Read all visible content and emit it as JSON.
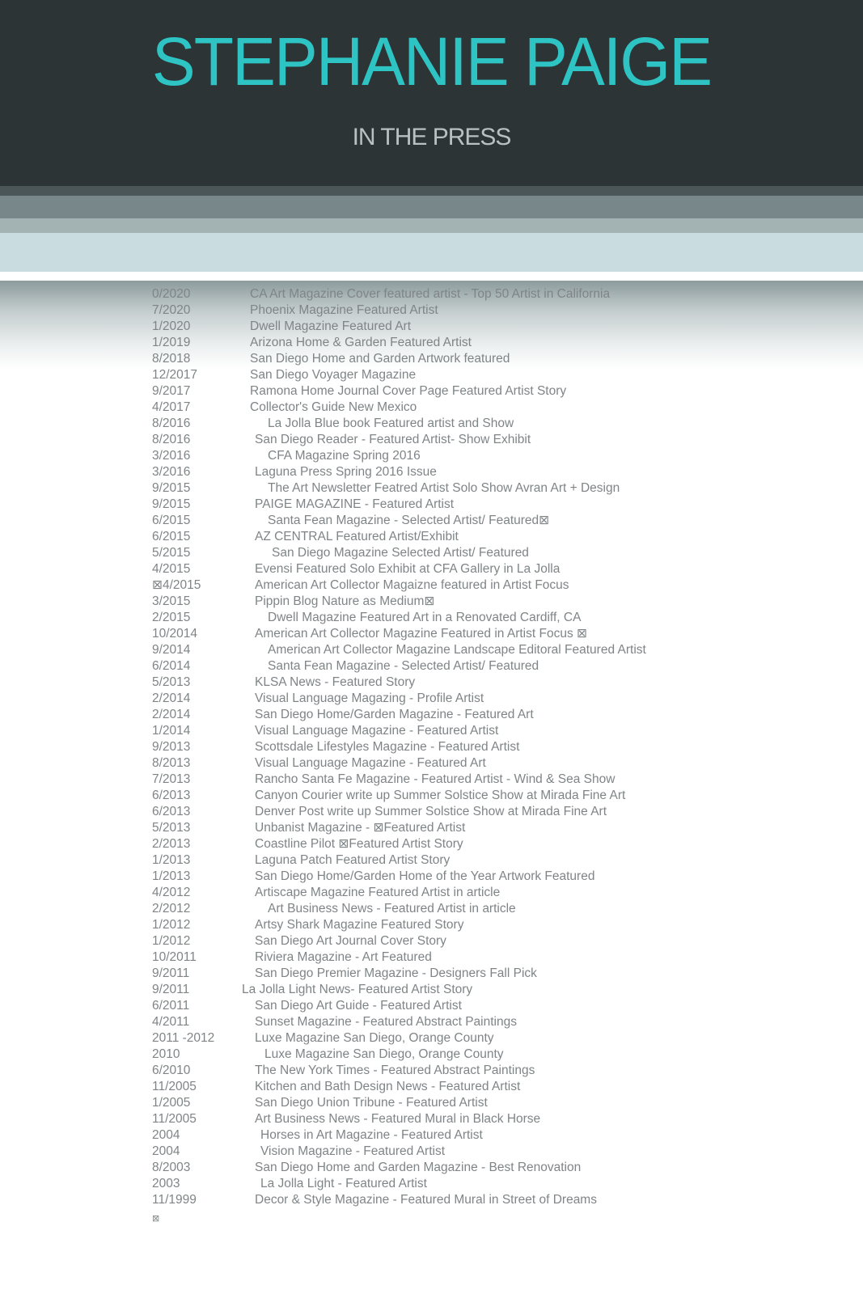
{
  "header": {
    "title": "STEPHANIE PAIGE",
    "subtitle": "IN THE PRESS"
  },
  "colors": {
    "header_bg": "#2d3436",
    "title": "#2ec4c4",
    "subtitle": "#b9c0c2",
    "text": "#7f8587"
  },
  "press": [
    {
      "date": "0/2020",
      "text": "CA Art Magazine Cover featured artist - Top 50 Artist in California"
    },
    {
      "date": "7/2020",
      "text": "Phoenix Magazine Featured Artist"
    },
    {
      "date": "1/2020",
      "text": "Dwell Magazine Featured Art"
    },
    {
      "date": "1/2019",
      "text": "Arizona Home & Garden Featured Artist"
    },
    {
      "date": "8/2018",
      "text": "San Diego Home and Garden Artwork featured"
    },
    {
      "date": "12/2017",
      "text": "San Diego Voyager Magazine"
    },
    {
      "date": "9/2017",
      "text": "Ramona Home Journal  Cover Page Featured Artist Story"
    },
    {
      "date": "4/2017",
      "text": "Collector's Guide  New Mexico"
    },
    {
      "date": "8/2016",
      "text": "La Jolla Blue  book Featured artist and Show"
    },
    {
      "date": "8/2016",
      "text": "San Diego Reader  - Featured Artist- Show Exhibit"
    },
    {
      "date": "3/2016",
      "text": "CFA Magazine Spring 2016"
    },
    {
      "date": "3/2016",
      "text": "Laguna Press Spring 2016 Issue"
    },
    {
      "date": "9/2015",
      "text": "The Art Newsletter  Featred Artist Solo Show Avran Art + Design"
    },
    {
      "date": "9/2015",
      "text": "PAIGE MAGAZINE  - Featured Artist"
    },
    {
      "date": "6/2015",
      "text": "Santa Fean Magazine -  Selected Artist/ Featured⊠"
    },
    {
      "date": "6/2015",
      "text": "AZ CENTRAL    Featured Artist/Exhibit"
    },
    {
      "date": "5/2015",
      "text": "San Diego Magazine Selected Artist/ Featured"
    },
    {
      "date": "4/2015",
      "text": "Evensi    Featured Solo Exhibit at CFA Gallery in La Jolla"
    },
    {
      "date": "⊠4/2015",
      "text": "American Art Collector Magaizne featured in Artist Focus"
    },
    {
      "date": "3/2015",
      "text": "Pippin Blog   Nature as Medium⊠"
    },
    {
      "date": "2/2015",
      "text": "Dwell Magazine Featured Art in a Renovated Cardiff, CA"
    },
    {
      "date": "10/2014",
      "text": "American Art Collector Magazine Featured in Artist Focus  ⊠"
    },
    {
      "date": "9/2014",
      "text": "American Art Collector Magazine  Landscape Editoral Featured Artist"
    },
    {
      "date": "6/2014",
      "text": "Santa Fean Magazine  - Selected Artist/ Featured"
    },
    {
      "date": "5/2013",
      "text": "KLSA News  - Featured Story"
    },
    {
      "date": "2/2014",
      "text": "Visual Language Magazing  - Profile Artist"
    },
    {
      "date": "2/2014",
      "text": "San Diego Home/Garden Magazine  - Featured Art"
    },
    {
      "date": "1/2014",
      "text": "Visual Language Magazine  - Featured   Artist"
    },
    {
      "date": "9/2013",
      "text": "Scottsdale Lifestyles Magazine  - Featured Artist"
    },
    {
      "date": "8/2013",
      "text": "Visual Language Magazine  - Featured Art"
    },
    {
      "date": "7/2013",
      "text": "Rancho Santa Fe Magazine  - Featured Artist - Wind & Sea Show"
    },
    {
      "date": "6/2013",
      "text": "Canyon Courier  write up Summer Solstice Show at Mirada Fine Art"
    },
    {
      "date": "6/2013",
      "text": "Denver Post  write up Summer Solstice Show at Mirada Fine Art"
    },
    {
      "date": "5/2013",
      "text": "Unbanist Magazine  -    ⊠Featured Artist"
    },
    {
      "date": "2/2013",
      "text": "Coastline Pilot    ⊠Featured Artist Story"
    },
    {
      "date": "1/2013",
      "text": "Laguna Patch  Featured Artist Story"
    },
    {
      "date": "1/2013",
      "text": "San Diego Home/Garden Home  of the Year Artwork Featured"
    },
    {
      "date": "4/2012",
      "text": "Artiscape Magazine  Featured Artist in article"
    },
    {
      "date": "2/2012",
      "text": "Art Business News    - Featured Artist in article"
    },
    {
      "date": "1/2012",
      "text": "Artsy Shark Magazine  Featured Story"
    },
    {
      "date": "1/2012",
      "text": "San Diego Art Journal Cover Story"
    },
    {
      "date": "10/2011",
      "text": "Riviera Magazine  - Art Featured"
    },
    {
      "date": "9/2011",
      "text": "San Diego Premier Magazine  - Designers Fall Pick"
    },
    {
      "date": "9/2011",
      "text": "La Jolla Light News- Featured Artist Story"
    },
    {
      "date": "6/2011",
      "text": "San Diego Art Guide  - Featured Artist"
    },
    {
      "date": "4/2011",
      "text": "Sunset Magazine  - Featured Abstract Paintings"
    },
    {
      "date": "2011 -2012",
      "text": "Luxe Magazine  San Diego, Orange County"
    },
    {
      "date": "2010",
      "text": "Luxe Magazine  San Diego, Orange County"
    },
    {
      "date": "6/2010",
      "text": "The New York Times  - Featured Abstract Paintings"
    },
    {
      "date": "11/2005",
      "text": "Kitchen and Bath Design News  - Featured Artist"
    },
    {
      "date": "1/2005",
      "text": "San Diego Union Tribune  - Featured Artist"
    },
    {
      "date": "11/2005",
      "text": "Art Business News  - Featured Mural in Black Horse"
    },
    {
      "date": "2004",
      "text": "Horses in Art Magazine  - Featured Artist"
    },
    {
      "date": "2004",
      "text": "Vision Magazine  - Featured Artist"
    },
    {
      "date": "8/2003",
      "text": "San Diego Home and Garden Magazine  - Best Renovation"
    },
    {
      "date": "2003",
      "text": "La Jolla Light  - Featured Artist"
    },
    {
      "date": "11/1999",
      "text": "Decor & Style Magazine  - Featured Mural in Street of  Dreams"
    }
  ],
  "tail_mark": "⊠"
}
